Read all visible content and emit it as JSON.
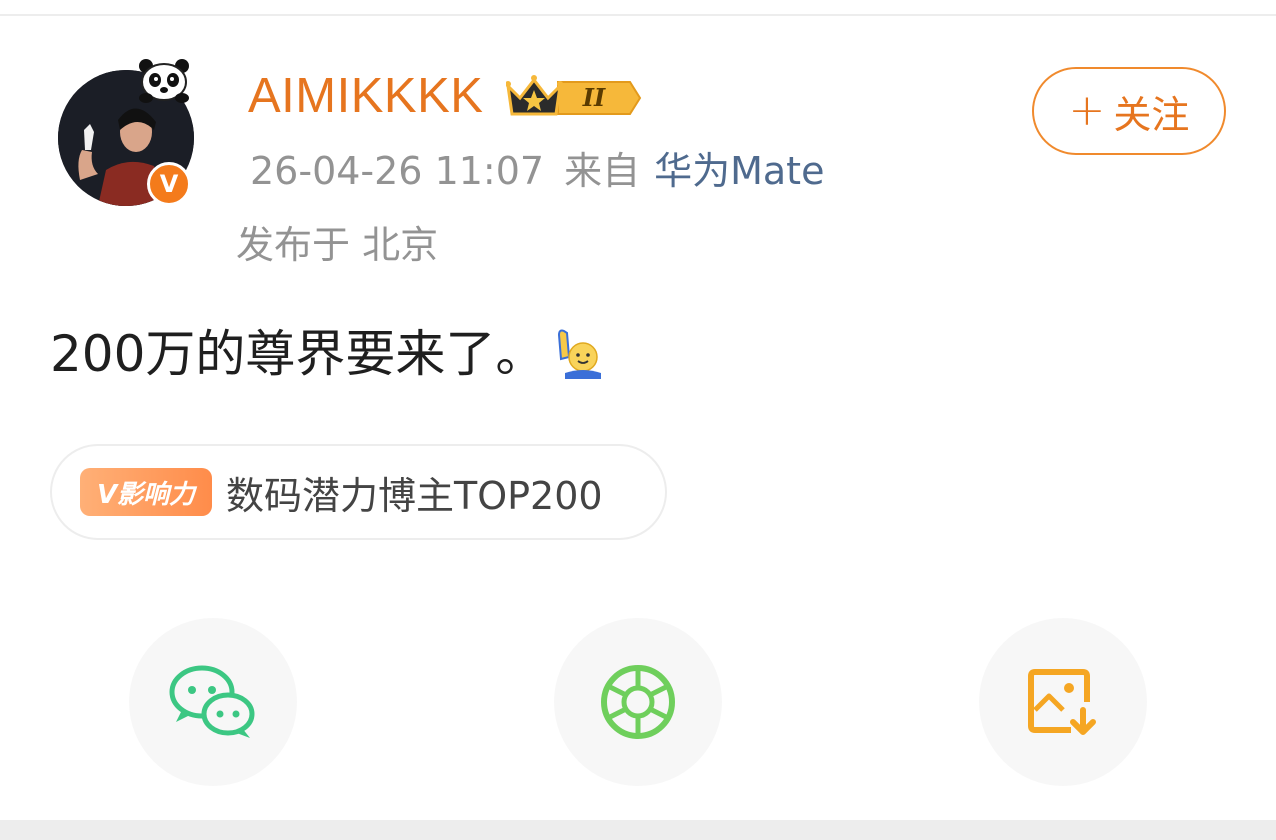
{
  "post": {
    "username": "AIMIKKKK",
    "level_badge": "II",
    "timestamp": "26-04-26 11:07",
    "from_label": "来自",
    "device": "华为Mate",
    "location": "发布于 北京",
    "text": "200万的尊界要来了。",
    "follow_label": "关注",
    "verified_mark": "V"
  },
  "tag": {
    "badge_label": "V影响力",
    "text": "数码潜力博主TOP200"
  },
  "share": {
    "icons": [
      "wechat-icon",
      "moments-icon",
      "save-image-icon"
    ]
  },
  "colors": {
    "accent": "#e6751f",
    "link": "#4f6a8e",
    "muted": "#939393",
    "wechat": "#3cc783",
    "moments": "#6fcf5c",
    "save": "#f5a623"
  }
}
